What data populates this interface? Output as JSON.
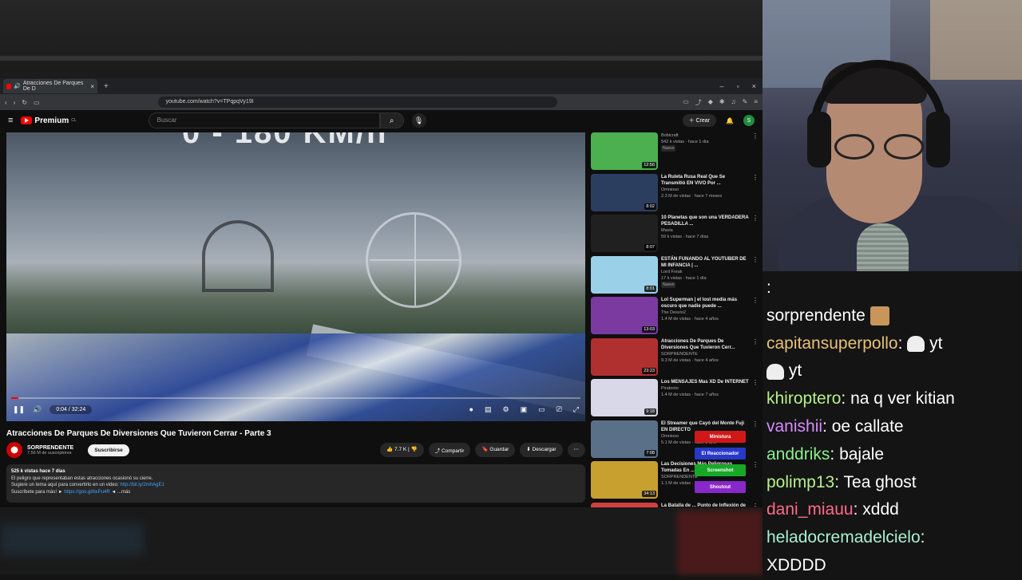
{
  "browser": {
    "tab_title": "Atracciones De Parques De D",
    "url": "youtube.com/watch?v=TPqpqVy19I"
  },
  "yt": {
    "logo_text": "Premium",
    "logo_region": "CL",
    "search_placeholder": "Buscar",
    "create_label": "Crear",
    "avatar_letter": "S"
  },
  "player": {
    "overlay_text": "0 - 180 KM/h",
    "time": "0:04 / 32:24",
    "progress": 0.002
  },
  "video": {
    "title": "Atracciones De Parques De Diversiones Que Tuvieron Cerrar - Parte 3",
    "channel": "SORPRENDENTE",
    "subscribers": "7.56 M de suscriptores",
    "subscribe_label": "Suscribirse",
    "likes": "7.7 K",
    "share_label": "Compartir",
    "save_label": "Guardar",
    "download_label": "Descargar",
    "desc_stats": "525 k vistas  hace 7 días",
    "desc_line1": "El peligro que representaban estas atracciones ocasionó su cierre.",
    "desc_line2_text": "Sugiere un tema aquí para convertirlo en un video: ",
    "desc_line2_link": "http://bit.ly/2mhAgE1",
    "desc_line3_text": "Suscríbete para más! ► ",
    "desc_line3_link": "https://goo.gl/bxPu4R",
    "desc_more": " ◄ ...más"
  },
  "recommendations": [
    {
      "title": "",
      "channel": "Bobicraft",
      "meta": "542 k vistas · hace 1 día",
      "badge": "Nuevo",
      "duration": "12:56",
      "color": "#4caf50"
    },
    {
      "title": "La Ruleta Rusa Real Que Se Transmitió EN VIVO Por ...",
      "channel": "Omnioso",
      "meta": "2.3 M de vistas · hace 7 meses",
      "badge": "",
      "duration": "8:02",
      "color": "#2c3e60"
    },
    {
      "title": "10 Planetas que son una VERDADERA PESADILLA ...",
      "channel": "Mavia",
      "meta": "59 k vistas · hace 7 días",
      "badge": "",
      "duration": "8:07",
      "color": "#202020"
    },
    {
      "title": "ESTÁN FUNANDO AL YOUTUBER DE MI INFANCIA | ...",
      "channel": "Lord Freak",
      "meta": "17 k vistas · hace 1 día",
      "badge": "Nuevo",
      "duration": "8:01",
      "color": "#9ad0e8"
    },
    {
      "title": "Lol Superman | el lost media más oscuro que nadie puede ...",
      "channel": "The Desvio2",
      "meta": "1.4 M de vistas · hace 4 años",
      "badge": "",
      "duration": "13:03",
      "color": "#7a3aa0"
    },
    {
      "title": "Atracciones De Parques De Diversiones Que Tuvieron Cerr...",
      "channel": "SORPRENDENTE",
      "meta": "9.3 M de vistas · hace 4 años",
      "badge": "",
      "duration": "23:23",
      "color": "#b03030"
    },
    {
      "title": "Los MENSAJES Mas XD De INTERNET",
      "channel": "Piratonio",
      "meta": "1.4 M de vistas · hace 7 años",
      "badge": "",
      "duration": "9:18",
      "color": "#d8d8e8"
    },
    {
      "title": "El Streamer que Cayó del Monte Fuji EN DIRECTO",
      "channel": "Omnioso",
      "meta": "5.1 M de vistas · hace 1 año",
      "badge": "",
      "duration": "7:08",
      "color": "#5a7088"
    },
    {
      "title": "Las Decisiones Más Peligrosas Tomadas En ...",
      "channel": "SORPRENDENTE",
      "meta": "1.1 M de vistas · hace 5 años",
      "badge": "",
      "duration": "34:13",
      "color": "#c8a030"
    },
    {
      "title": "La Batalla de ... Punto de Inflexión de la ...",
      "channel": "",
      "meta": "",
      "badge": "",
      "duration": "",
      "color": "#d04040"
    }
  ],
  "overlay_buttons": [
    {
      "label": "Ministura",
      "color": "#d01818"
    },
    {
      "label": "El Reaccionador",
      "color": "#2838c8"
    },
    {
      "label": "Screenshot",
      "color": "#18a828"
    },
    {
      "label": "Shoutout",
      "color": "#8828c8"
    }
  ],
  "chat": [
    {
      "user": "",
      "message": ":",
      "color": "#ffffff"
    },
    {
      "user": "",
      "message": "sorprendente",
      "color": "#ffffff",
      "emote": "cat"
    },
    {
      "user": "capitansuperpollo",
      "message": "yt",
      "color": "#e8c07a",
      "emote": "ghost"
    },
    {
      "user": "",
      "message": "yt",
      "color": "#ffffff",
      "emote": "ghost_pre"
    },
    {
      "user": "khiroptero",
      "message": "na q ver kitian",
      "color": "#b6f089"
    },
    {
      "user": "vanishii",
      "message": "oe callate",
      "color": "#d68cff"
    },
    {
      "user": "anddriks",
      "message": "bajale",
      "color": "#8bf08b"
    },
    {
      "user": "polimp13",
      "message": "Tea ghost",
      "color": "#b6f089"
    },
    {
      "user": "dani_miauu",
      "message": "xddd",
      "color": "#ff6b8a"
    },
    {
      "user": "heladocremadelcielo",
      "message": "",
      "color": "#a8f0d0"
    },
    {
      "user": "",
      "message": "XDDDD",
      "color": "#ffffff"
    }
  ]
}
